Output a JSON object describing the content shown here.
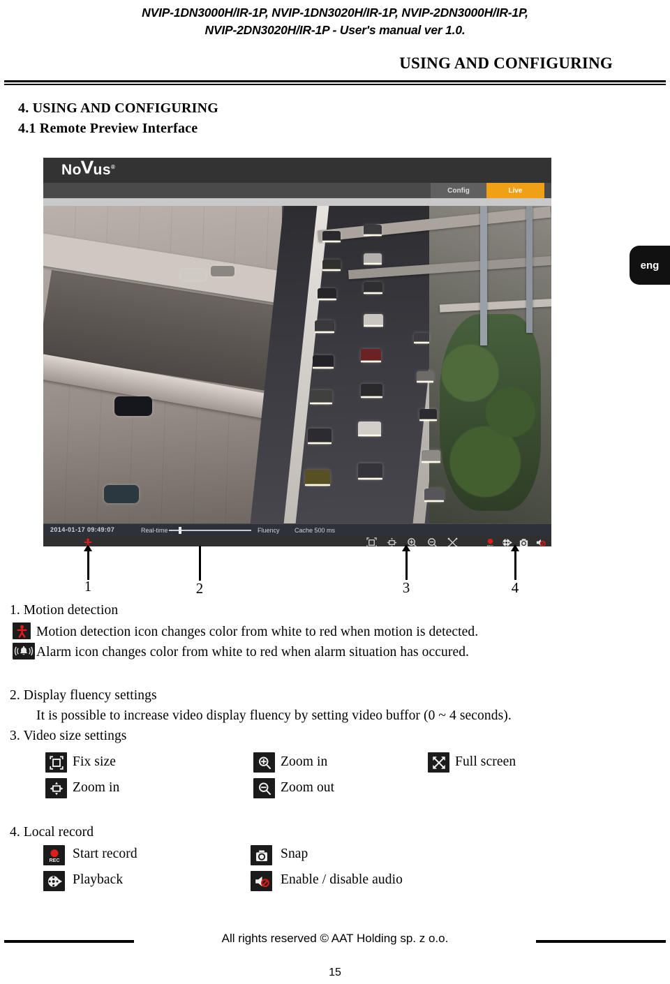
{
  "header": {
    "model_line1": "NVIP-1DN3000H/IR-1P, NVIP-1DN3020H/IR-1P, NVIP-2DN3000H/IR-1P,",
    "model_line2": "NVIP-2DN3020H/IR-1P - User's manual ver 1.0.",
    "section_banner": "USING AND CONFIGURING"
  },
  "headings": {
    "chapter": "4. USING AND CONFIGURING",
    "subsection": "4.1 Remote Preview Interface"
  },
  "language_tab": {
    "label": "eng"
  },
  "camera_ui": {
    "logo": {
      "pre": "No",
      "v": "V",
      "post": "us",
      "reg": "®"
    },
    "tabs": [
      {
        "label": "Config",
        "active": false
      },
      {
        "label": "Live",
        "active": true
      }
    ],
    "statusbar": {
      "timestamp": "2014-01-17 09:49:07",
      "realtime_label": "Real-time",
      "fluency_label": "Fluency",
      "cache_label": "Cache 500 ms"
    },
    "toolbar_icons_left": [
      "fix-size-icon",
      "zoom-fit-icon",
      "zoom-in-icon",
      "zoom-out-icon",
      "full-screen-icon"
    ],
    "toolbar_icons_right": [
      "record-icon",
      "playback-icon",
      "snapshot-icon",
      "audio-icon"
    ],
    "motion_icon": "motion-detection-icon",
    "accent_color": "#f0a014"
  },
  "callouts": [
    {
      "number": "1"
    },
    {
      "number": "2"
    },
    {
      "number": "3"
    },
    {
      "number": "4"
    }
  ],
  "sections": {
    "s1": {
      "title": "1. Motion detection",
      "line1": "Motion detection icon changes color from white to red when motion is detected.",
      "line2": "Alarm icon changes color from white to red when alarm situation has occured.",
      "icon1": "motion-detection-icon",
      "icon2": "alarm-bell-icon"
    },
    "s2": {
      "title": "2. Display fluency settings",
      "line1": "It is possible to increase video display fluency by setting video buffor (0 ~ 4 seconds)."
    },
    "s3": {
      "title": "3. Video size settings",
      "items": [
        {
          "label": "Fix size",
          "icon": "fix-size-icon"
        },
        {
          "label": "Zoom in",
          "icon": "zoom-fit-icon"
        },
        {
          "label": "Zoom in",
          "icon": "magnifier-plus-icon"
        },
        {
          "label": "Zoom out",
          "icon": "magnifier-minus-icon"
        },
        {
          "label": "Full screen",
          "icon": "full-screen-icon"
        }
      ]
    },
    "s4": {
      "title": "4. Local record",
      "items": [
        {
          "label": "Start record",
          "icon": "record-icon"
        },
        {
          "label": "Playback",
          "icon": "playback-film-icon"
        },
        {
          "label": "Snap",
          "icon": "snapshot-camera-icon"
        },
        {
          "label": "Enable / disable audio",
          "icon": "audio-mute-icon"
        }
      ]
    }
  },
  "footer": {
    "copyright": "All rights reserved © AAT Holding sp. z o.o.",
    "page_number": "15"
  }
}
